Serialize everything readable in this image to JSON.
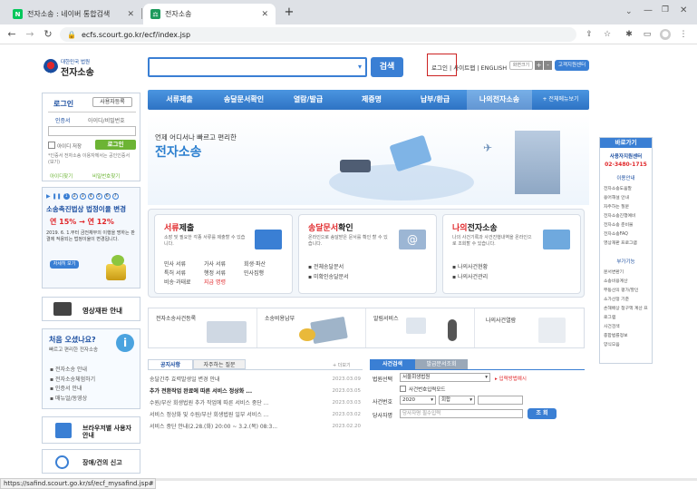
{
  "browser": {
    "tabs": [
      {
        "title": "전자소송 : 네이버 통합검색",
        "favicon": "N",
        "active": false
      },
      {
        "title": "전자소송",
        "favicon": "",
        "active": true
      }
    ],
    "new_tab": "+",
    "url": "ecfs.scourt.go.kr/ecf/index.jsp",
    "status_url": "https://safind.scourt.go.kr/sf/ecf_mysafind.jsp#"
  },
  "header": {
    "logo_top": "대한민국 법원",
    "logo_main": "전자소송",
    "search_placeholder": "",
    "search_button": "검색",
    "top_links": [
      "로그인",
      "사이트맵",
      "ENGLISH"
    ],
    "zoom_label": "화면크기",
    "zoom_plus": "+",
    "zoom_minus": "-",
    "support_button": "고객지원센터"
  },
  "gnb": {
    "items": [
      "서류제출",
      "송달문서확인",
      "열람/발급",
      "제증명",
      "납부/환급",
      "나의전자소송"
    ],
    "all_menu": "+ 전체메뉴보기"
  },
  "login": {
    "title": "로그인",
    "register": "사용자등록",
    "tabs": [
      "인증서",
      "아이디/비밀번호"
    ],
    "save_id": "아이디 저장",
    "login_button": "로그인",
    "notice": "*인증서 전자소송 이용자께서는 공인인증서 (보기)",
    "find_id": "아이디찾기",
    "find_pw": "비밀번호찾기"
  },
  "promo": {
    "title": "소송촉진법상 법정이율 변경",
    "rate": "연 15% → 연 12%",
    "desc": "2019. 6. 1.부터 금전채무의 이행을 명하는 판결에 적용되는 법정이율이 변경됩니다.",
    "more": "자세히 보기",
    "pages": [
      "1",
      "2",
      "3",
      "4",
      "5",
      "6",
      "7"
    ]
  },
  "side_links": {
    "video": "영상재판 안내",
    "first_title": "처음 오셨나요?",
    "first_sub": "빠르고 편리한 전자소송",
    "first_items": [
      "전자소송 안내",
      "전자소송체험하기",
      "인증서 안내",
      "매뉴얼/동영상"
    ],
    "browser": "브라우저별 사용자안내",
    "report": "장애/건의 신고"
  },
  "hero": {
    "sub": "언제 어디서나 빠르고 편리한",
    "title": "전자소송"
  },
  "services": [
    {
      "title_a": "서류",
      "title_b": "제출",
      "desc": "소장 및 필요한 각종 서류를 제출할 수 있습니다.",
      "items": [
        "민사 서류",
        "가사 서류",
        "회생·파산",
        "특허 서류",
        "행정 서류",
        "민사집행",
        "비송·과태료",
        "지급 명령"
      ]
    },
    {
      "title_a": "송달문서",
      "title_b": "확인",
      "desc": "온라인으로 송달받은 문서를 확인 할 수 있습니다.",
      "items": [
        "전체송달문서",
        "미확인송달문서"
      ]
    },
    {
      "title_a": "나의",
      "title_b": "전자소송",
      "desc": "나의 사건기록과 사건진행내역을 온라인으로 조회할 수 있습니다.",
      "items": [
        "나의사건현황",
        "나의사건관리"
      ]
    }
  ],
  "quick": [
    "전자소송사건등록",
    "소송비용납부",
    "알림서비스",
    "나의사건열람"
  ],
  "notice": {
    "tabs": [
      "공지사항",
      "자주하는 질문"
    ],
    "more": "+ 더보기",
    "items": [
      {
        "text": "송달간주 효력발생일 변경 안내",
        "date": "2023.03.09",
        "bold": false
      },
      {
        "text": "추가 전환작업 완료에 따른 서비스 정상화 ...",
        "date": "2023.03.05",
        "bold": true
      },
      {
        "text": "수원/부산 회생법원 추가 작업에 따른 서비스 중단 ...",
        "date": "2023.03.03",
        "bold": false
      },
      {
        "text": "서비스 정상화 및 수원/부산 회생법원 일부 서비스 ...",
        "date": "2023.03.02",
        "bold": false
      },
      {
        "text": "서비스 중단 안내(2.28.(화) 20:00 ~ 3.2.(목) 08:3...",
        "date": "2023.02.20",
        "bold": false
      }
    ]
  },
  "case_search": {
    "tabs": [
      "사건검색",
      "발급문서조회"
    ],
    "court_label": "법원선택",
    "court_value": "서울회생법원",
    "direct": "입력방법예시",
    "case_check": "사건번호입력모드",
    "caseno_label": "사건번호",
    "year": "2020",
    "type": "회합",
    "party_label": "당사자명",
    "party_placeholder": "당사자명 필수입력",
    "search_button": "조 회"
  },
  "right": {
    "title": "바로가기",
    "center": "사용자지원센터",
    "phone": "02-3480-1715",
    "usage_title": "이용안내",
    "usage": [
      "전자소송도움말",
      "용어해설 안내",
      "자주하는 질문",
      "전자소송진행예비",
      "전자소송 준비물",
      "전자소송FAQ",
      "영상재판 프로그램"
    ],
    "extra_title": "부가기능",
    "extra": [
      "문서변환기",
      "소송비용계산",
      "부동산의 평가/할인",
      "소가산정 기준",
      "손해배상 청구액 계산 프로그램",
      "사건검색",
      "종합법률정보",
      "양식모음"
    ]
  },
  "colors": {
    "accent": "#3a7fd4",
    "login_green": "#6cb434",
    "menu_blue": "#3b87d6",
    "promo_red": "#e0282b"
  }
}
